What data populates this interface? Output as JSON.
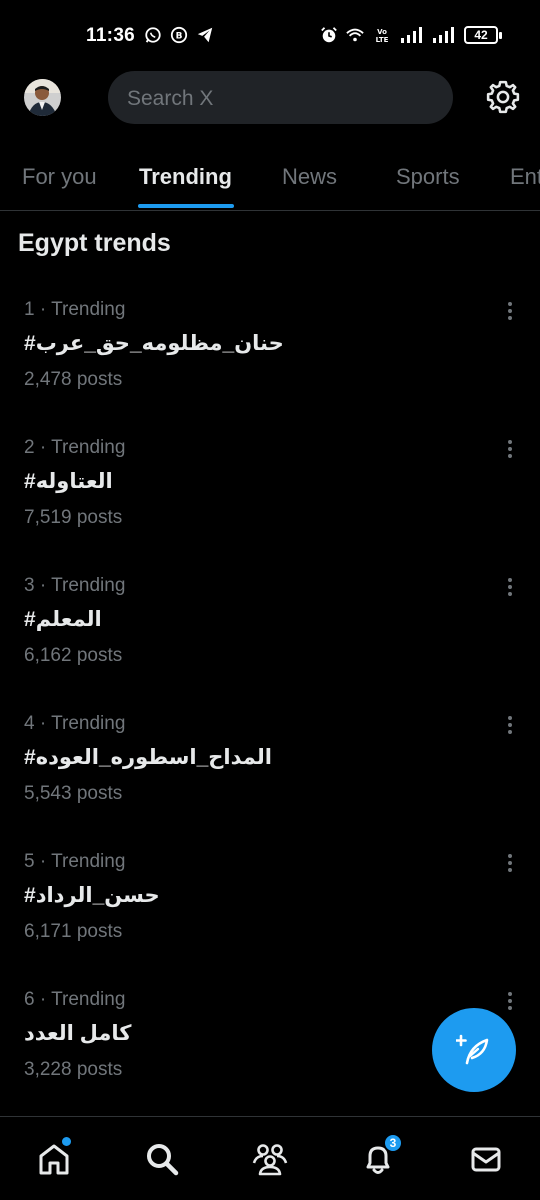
{
  "status_bar": {
    "time": "11:36",
    "battery": "42",
    "left_icons": [
      "whatsapp-icon",
      "bitcoin-icon",
      "telegram-icon"
    ],
    "right_icons": [
      "alarm-icon",
      "wifi-icon",
      "volte-icon",
      "signal-icon",
      "signal-icon",
      "battery-icon"
    ]
  },
  "header": {
    "search_placeholder": "Search X"
  },
  "tabs": [
    {
      "label": "For you"
    },
    {
      "label": "Trending"
    },
    {
      "label": "News"
    },
    {
      "label": "Sports"
    },
    {
      "label": "Ent"
    }
  ],
  "section": {
    "title": "Egypt trends"
  },
  "trends": [
    {
      "meta": "1 · Trending",
      "name": "#حنان_مظلومه_حق_عرب",
      "count": "2,478 posts"
    },
    {
      "meta": "2 · Trending",
      "name": "#العتاوله",
      "count": "7,519 posts"
    },
    {
      "meta": "3 · Trending",
      "name": "#المعلم",
      "count": "6,162 posts"
    },
    {
      "meta": "4 · Trending",
      "name": "#المداح_اسطوره_العوده",
      "count": "5,543 posts"
    },
    {
      "meta": "5 · Trending",
      "name": "#حسن_الرداد",
      "count": "6,171 posts"
    },
    {
      "meta": "6 · Trending",
      "name": "كامل العدد",
      "count": "3,228 posts"
    }
  ],
  "bottom_nav": {
    "items": [
      "home-icon",
      "search-icon",
      "communities-icon",
      "notifications-icon",
      "messages-icon"
    ],
    "notifications_badge": "3"
  },
  "colors": {
    "accent": "#1d9bf0",
    "background": "#000000",
    "muted_text": "#71767b",
    "primary_text": "#e7e9ea"
  }
}
